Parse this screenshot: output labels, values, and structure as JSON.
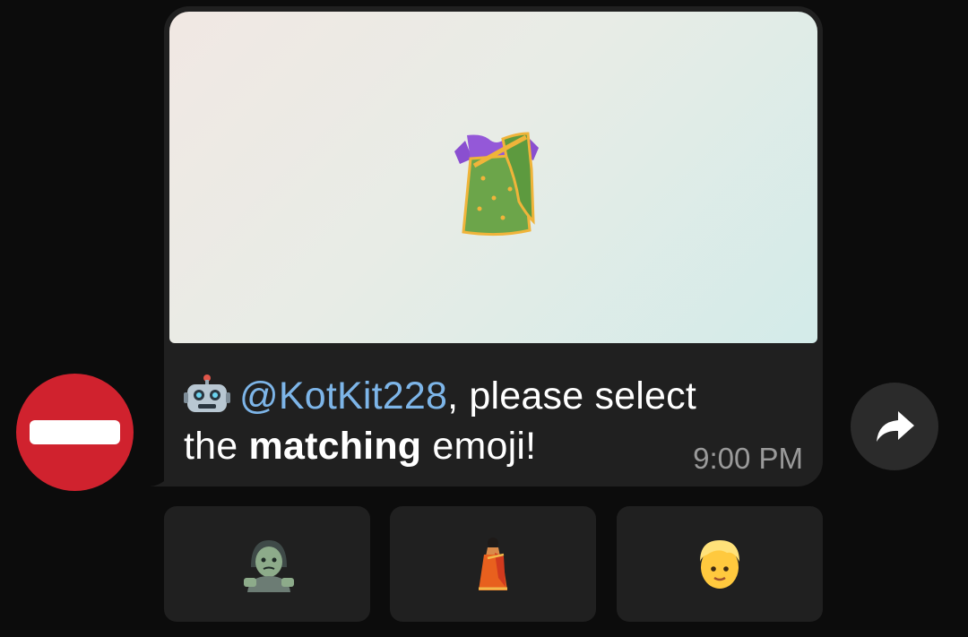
{
  "chat": {
    "message": {
      "image_emoji": "sari",
      "caption": {
        "bot_icon": "robot-icon",
        "mention": "@KotKit228",
        "text_part1": ", please select",
        "text_part2_prefix": "the ",
        "text_part2_bold": "matching",
        "text_part2_suffix": " emoji!"
      },
      "time": "9:00 PM"
    },
    "avatar_icon": "no-entry-icon",
    "forward_icon": "share-arrow-icon",
    "keyboard": [
      {
        "emoji": "zombie-icon"
      },
      {
        "emoji": "sari-icon"
      },
      {
        "emoji": "person-blond-hair-icon"
      }
    ]
  }
}
